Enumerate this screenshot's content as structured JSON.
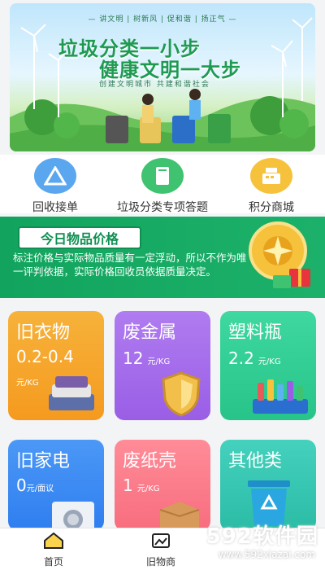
{
  "banner": {
    "slogans": "— 讲文明 | 树新风 | 促和谐 | 扬正气 —",
    "title_line1": "垃圾分类一小步",
    "title_line2": "健康文明一大步",
    "subtitle": "创建文明城市 共建和谐社会"
  },
  "actions": [
    {
      "label": "回收接单",
      "icon": "recycle-order-icon",
      "color": "#5aa7f0"
    },
    {
      "label": "垃圾分类专项答题",
      "icon": "book-icon",
      "color": "#3fc370"
    },
    {
      "label": "积分商城",
      "icon": "cash-register-icon",
      "color": "#f6c23c"
    }
  ],
  "price_section": {
    "title": "今日物品价格",
    "note": "标注价格与实际物品质量有一定浮动，所以不作为唯一评判依据，实际价格回收员依据质量决定。"
  },
  "categories": [
    {
      "name": "旧衣物",
      "price": "0.2-0.4",
      "unit": "元/KG",
      "color": "#f5a623",
      "icon": "clothes-icon"
    },
    {
      "name": "废金属",
      "price": "12",
      "unit": "元/KG",
      "color": "#a16ae8",
      "icon": "shield-icon"
    },
    {
      "name": "塑料瓶",
      "price": "2.2",
      "unit": "元/KG",
      "color": "#2fcf94",
      "icon": "bottles-icon"
    },
    {
      "name": "旧家电",
      "price": "0",
      "unit": "元/面议",
      "color": "#3d8cf4",
      "icon": "washing-machine-icon"
    },
    {
      "name": "废纸壳",
      "price": "1",
      "unit": "元/KG",
      "color": "#f97a8a",
      "icon": "cardboard-box-icon"
    },
    {
      "name": "其他类",
      "price": "",
      "unit": "",
      "color": "#35c6b0",
      "icon": "recycle-bin-icon"
    }
  ],
  "nav": [
    {
      "label": "首页",
      "icon": "home-icon"
    },
    {
      "label": "旧物商",
      "icon": "shop-icon"
    }
  ],
  "watermark": {
    "brand": "592软件园",
    "url": "www.592xiazai.com"
  }
}
